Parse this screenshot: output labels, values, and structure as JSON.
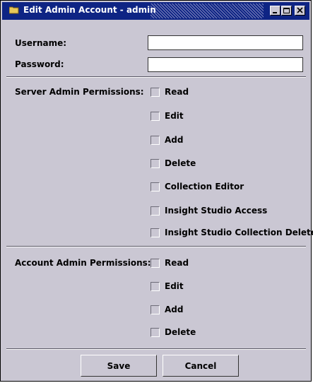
{
  "window": {
    "title": "Edit Admin Account - admin"
  },
  "form": {
    "username_label": "Username:",
    "username_value": "",
    "password_label": "Password:",
    "password_value": ""
  },
  "server_permissions": {
    "label": "Server Admin Permissions:",
    "items": [
      {
        "label": "Read",
        "checked": false
      },
      {
        "label": "Edit",
        "checked": false
      },
      {
        "label": "Add",
        "checked": false
      },
      {
        "label": "Delete",
        "checked": false
      },
      {
        "label": "Collection Editor",
        "checked": false
      },
      {
        "label": "Insight Studio Access",
        "checked": false
      },
      {
        "label": "Insight Studio Collection Delete",
        "checked": false
      }
    ]
  },
  "account_permissions": {
    "label": "Account Admin Permissions:",
    "items": [
      {
        "label": "Read",
        "checked": false
      },
      {
        "label": "Edit",
        "checked": false
      },
      {
        "label": "Add",
        "checked": false
      },
      {
        "label": "Delete",
        "checked": false
      }
    ]
  },
  "buttons": {
    "save": "Save",
    "cancel": "Cancel"
  },
  "icons": {
    "title": "folder-icon",
    "minimize": "minimize-icon",
    "maximize": "maximize-icon",
    "close": "close-icon"
  },
  "colors": {
    "titlebar": "#0e2484",
    "background": "#cac7d3"
  }
}
